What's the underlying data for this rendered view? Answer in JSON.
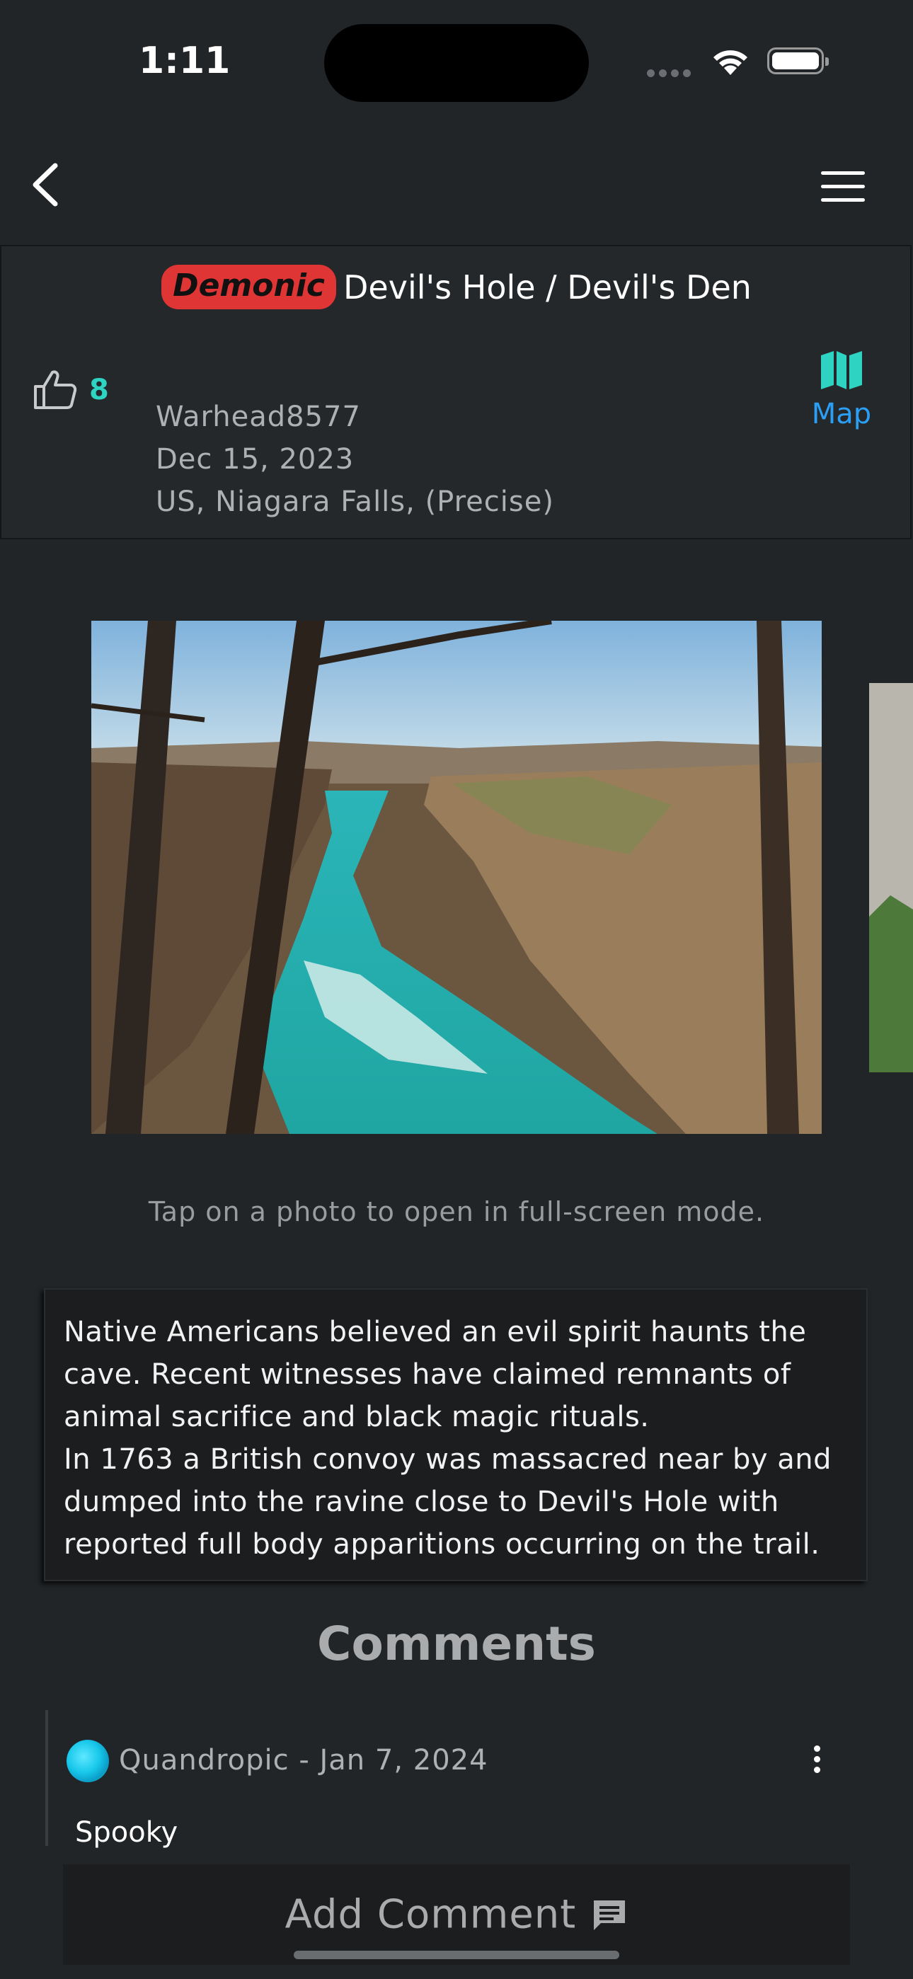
{
  "status_bar": {
    "time": "1:11"
  },
  "nav": {
    "back_icon": "chevron-left-icon",
    "menu_icon": "hamburger-menu-icon"
  },
  "post": {
    "category_badge": "Demonic",
    "title": "Devil's Hole / Devil's Den",
    "likes": "8",
    "author": "Warhead8577",
    "date": "Dec 15, 2023",
    "location": "US, Niagara Falls, (Precise)",
    "map_label": "Map",
    "photo_hint": "Tap on a photo to open in full-screen mode.",
    "description": "Native Americans believed an evil spirit haunts the cave. Recent witnesses have claimed remnants of animal sacrifice and black magic rituals.\nIn 1763 a British convoy was massacred near by and dumped into the ravine close to Devil's Hole with reported full body apparitions occurring on the trail."
  },
  "comments": {
    "heading": "Comments",
    "items": [
      {
        "author_line": "Quandropic - Jan 7, 2024",
        "text": "Spooky"
      }
    ]
  },
  "add_comment": {
    "label": "Add Comment"
  },
  "colors": {
    "accent_teal": "#2fd3c1",
    "link_blue": "#2a9ff5",
    "badge_red": "#e03535",
    "background": "#222528"
  }
}
